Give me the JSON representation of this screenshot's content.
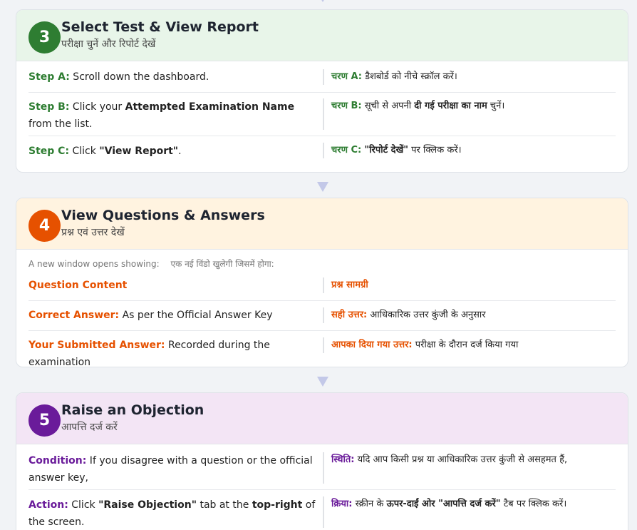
{
  "step3": {
    "number": "3",
    "title": "Select Test & View Report",
    "subtitle": "परीक्षा चुनें और रिपोर्ट देखें",
    "rows": [
      {
        "en_label": "Step A:",
        "en_text": " Scroll down the dashboard.",
        "hi_label": "चरण A:",
        "hi_text": " डैशबोर्ड को नीचे स्क्रॉल करें।"
      },
      {
        "en_label": "Step B:",
        "en_pre": " Click your ",
        "en_bold": "Attempted Examination Name",
        "en_post": " from the list.",
        "hi_label": "चरण B:",
        "hi_pre": " सूची से अपनी ",
        "hi_bold": "दी गई परीक्षा का नाम",
        "hi_post": " चुनें।"
      },
      {
        "en_label": "Step C:",
        "en_pre": " Click ",
        "en_bold": "\"View Report\"",
        "en_post": ".",
        "hi_label": "चरण C:",
        "hi_pre": " ",
        "hi_bold": "\"रिपोर्ट देखें\"",
        "hi_post": " पर क्लिक करें।"
      }
    ]
  },
  "step4": {
    "number": "4",
    "title": "View Questions & Answers",
    "subtitle": "प्रश्न एवं उत्तर देखें",
    "intro_en": "A new window opens showing:",
    "intro_hi": "एक नई विंडो खुलेगी जिसमें होगा:",
    "rows": [
      {
        "en_label": "Question Content",
        "en_text": "",
        "hi_label": "प्रश्न सामग्री",
        "hi_text": ""
      },
      {
        "en_label": "Correct Answer:",
        "en_text": " As per the Official Answer Key",
        "hi_label": "सही उत्तर:",
        "hi_text": " आधिकारिक उत्तर कुंजी के अनुसार"
      },
      {
        "en_label": "Your Submitted Answer:",
        "en_text": " Recorded during the examination",
        "hi_label": "आपका दिया गया उत्तर:",
        "hi_text": " परीक्षा के दौरान दर्ज किया गया"
      }
    ]
  },
  "step5": {
    "number": "5",
    "title": "Raise an Objection",
    "subtitle": "आपत्ति दर्ज करें",
    "rows": [
      {
        "en_label": "Condition:",
        "en_text": " If you disagree with a question or the official answer key,",
        "hi_label": "स्थिति:",
        "hi_text": " यदि आप किसी प्रश्न या आधिकारिक उत्तर कुंजी से असहमत हैं,"
      },
      {
        "en_label": "Action:",
        "en_pre": " Click ",
        "en_bold": "\"Raise Objection\"",
        "en_mid": " tab at the ",
        "en_bold2": "top-right",
        "en_post": " of the screen.",
        "hi_label": "क्रिया:",
        "hi_pre": " स्क्रीन के ",
        "hi_bold": "ऊपर-दाईं ओर \"आपत्ति दर्ज करें\"",
        "hi_post": " टैब पर क्लिक करें।"
      }
    ]
  }
}
